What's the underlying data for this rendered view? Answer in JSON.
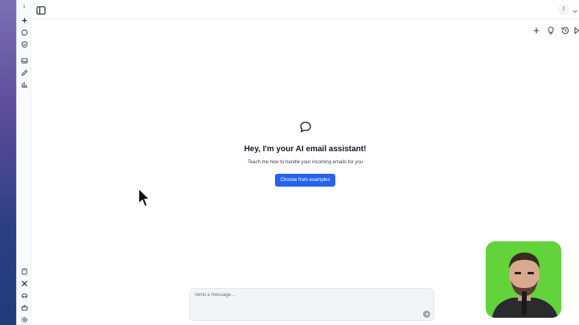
{
  "rail": {
    "top_label": "1",
    "icons": [
      "sparkles-icon",
      "chat-icon",
      "shield-check-icon",
      "inbox-icon",
      "pen-icon",
      "bar-chart-icon"
    ],
    "bottom_icons": [
      "book-icon",
      "x-logo-icon",
      "car-icon",
      "basket-icon",
      "gear-icon"
    ]
  },
  "header": {
    "sidebar_toggle_icon": "sidebar-toggle-icon",
    "avatar_initial": "I"
  },
  "toolbar": {
    "icons": [
      "plus-icon",
      "lightbulb-icon",
      "history-icon",
      "play-icon"
    ]
  },
  "empty_state": {
    "icon": "chat-bubble-icon",
    "title": "Hey, I'm your AI email assistant!",
    "subtitle": "Teach me how to handle your incoming emails for you",
    "cta_label": "Choose from examples"
  },
  "composer": {
    "placeholder": "Send a message..."
  },
  "colors": {
    "accent": "#2563eb",
    "webcam_bg": "#62d33a"
  }
}
